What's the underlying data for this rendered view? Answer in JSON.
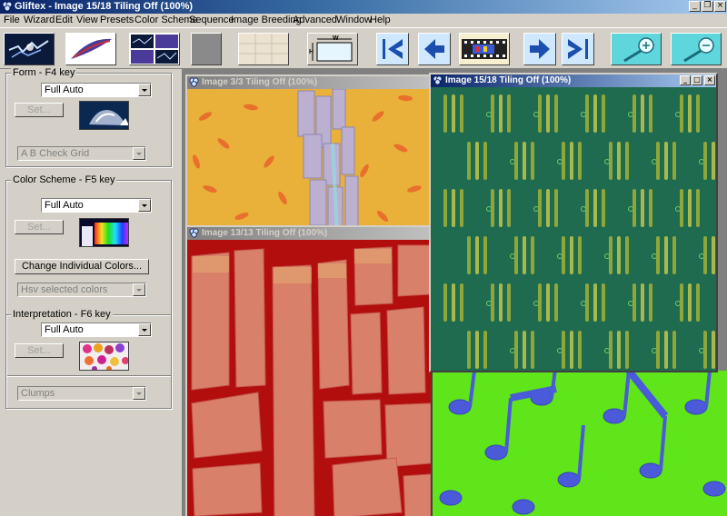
{
  "window": {
    "title": "Gliftex - Image 15/18 Tiling Off (100%)",
    "app_icon": "gliftex-app-icon",
    "controls": [
      "minimize",
      "restore",
      "close"
    ]
  },
  "menu": [
    "File",
    "Wizard",
    "Edit",
    "View",
    "Presets",
    "Color Scheme",
    "Sequence",
    "Image Breeding",
    "Advanced",
    "Window",
    "Help"
  ],
  "toolbar": {
    "buttons": [
      "lightning-image",
      "feather-image",
      "multi-image",
      "blank-gray",
      "parchment-pattern",
      "image-size",
      "first-image",
      "previous-image",
      "filmstrip",
      "next-image",
      "last-image",
      "zoom-in",
      "zoom-out"
    ],
    "size_label": "W",
    "size_label_h": "H"
  },
  "form_group": {
    "label": "Form - F4 key",
    "select_value": "Full Auto",
    "set_label": "Set...",
    "sub_select": "A B Check Grid"
  },
  "color_group": {
    "label": "Color Scheme - F5 key",
    "select_value": "Full Auto",
    "set_label": "Set...",
    "change_label": "Change Individual Colors...",
    "sub_select": "Hsv selected colors"
  },
  "interp_group": {
    "label": "Interpretation - F6 key",
    "select_value": "Full Auto",
    "set_label": "Set...",
    "sub_select": "Clumps"
  },
  "windows": [
    {
      "title": "Image 3/3 Tiling Off (100%)",
      "active": false
    },
    {
      "title": "Image 13/13 Tiling Off (100%)",
      "active": false
    },
    {
      "title": "Image 15/18 Tiling Off (100%)",
      "active": true
    }
  ],
  "colors": {
    "active_title": "#0a246a",
    "orange_canvas": "#e9b03a",
    "red_canvas": "#b30e0e",
    "green_canvas": "#1f6b4f",
    "lime_canvas": "#5fe51a"
  }
}
